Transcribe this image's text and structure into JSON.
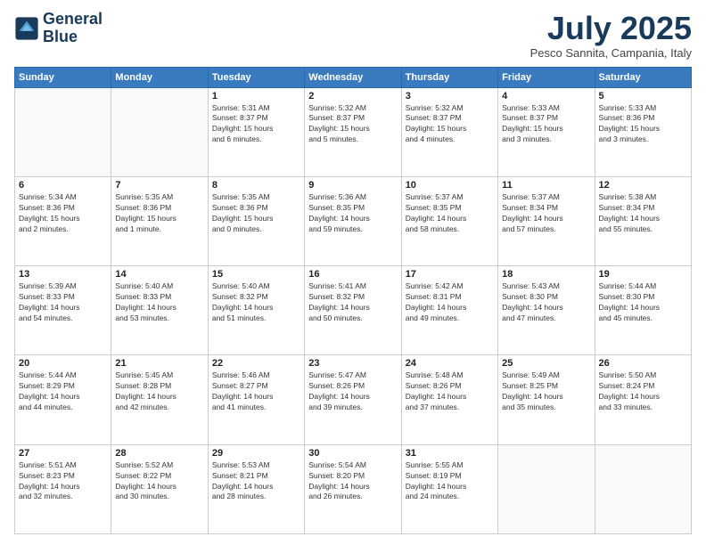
{
  "header": {
    "logo_line1": "General",
    "logo_line2": "Blue",
    "month": "July 2025",
    "location": "Pesco Sannita, Campania, Italy"
  },
  "days_of_week": [
    "Sunday",
    "Monday",
    "Tuesday",
    "Wednesday",
    "Thursday",
    "Friday",
    "Saturday"
  ],
  "weeks": [
    [
      {
        "day": "",
        "info": ""
      },
      {
        "day": "",
        "info": ""
      },
      {
        "day": "1",
        "info": "Sunrise: 5:31 AM\nSunset: 8:37 PM\nDaylight: 15 hours\nand 6 minutes."
      },
      {
        "day": "2",
        "info": "Sunrise: 5:32 AM\nSunset: 8:37 PM\nDaylight: 15 hours\nand 5 minutes."
      },
      {
        "day": "3",
        "info": "Sunrise: 5:32 AM\nSunset: 8:37 PM\nDaylight: 15 hours\nand 4 minutes."
      },
      {
        "day": "4",
        "info": "Sunrise: 5:33 AM\nSunset: 8:37 PM\nDaylight: 15 hours\nand 3 minutes."
      },
      {
        "day": "5",
        "info": "Sunrise: 5:33 AM\nSunset: 8:36 PM\nDaylight: 15 hours\nand 3 minutes."
      }
    ],
    [
      {
        "day": "6",
        "info": "Sunrise: 5:34 AM\nSunset: 8:36 PM\nDaylight: 15 hours\nand 2 minutes."
      },
      {
        "day": "7",
        "info": "Sunrise: 5:35 AM\nSunset: 8:36 PM\nDaylight: 15 hours\nand 1 minute."
      },
      {
        "day": "8",
        "info": "Sunrise: 5:35 AM\nSunset: 8:36 PM\nDaylight: 15 hours\nand 0 minutes."
      },
      {
        "day": "9",
        "info": "Sunrise: 5:36 AM\nSunset: 8:35 PM\nDaylight: 14 hours\nand 59 minutes."
      },
      {
        "day": "10",
        "info": "Sunrise: 5:37 AM\nSunset: 8:35 PM\nDaylight: 14 hours\nand 58 minutes."
      },
      {
        "day": "11",
        "info": "Sunrise: 5:37 AM\nSunset: 8:34 PM\nDaylight: 14 hours\nand 57 minutes."
      },
      {
        "day": "12",
        "info": "Sunrise: 5:38 AM\nSunset: 8:34 PM\nDaylight: 14 hours\nand 55 minutes."
      }
    ],
    [
      {
        "day": "13",
        "info": "Sunrise: 5:39 AM\nSunset: 8:33 PM\nDaylight: 14 hours\nand 54 minutes."
      },
      {
        "day": "14",
        "info": "Sunrise: 5:40 AM\nSunset: 8:33 PM\nDaylight: 14 hours\nand 53 minutes."
      },
      {
        "day": "15",
        "info": "Sunrise: 5:40 AM\nSunset: 8:32 PM\nDaylight: 14 hours\nand 51 minutes."
      },
      {
        "day": "16",
        "info": "Sunrise: 5:41 AM\nSunset: 8:32 PM\nDaylight: 14 hours\nand 50 minutes."
      },
      {
        "day": "17",
        "info": "Sunrise: 5:42 AM\nSunset: 8:31 PM\nDaylight: 14 hours\nand 49 minutes."
      },
      {
        "day": "18",
        "info": "Sunrise: 5:43 AM\nSunset: 8:30 PM\nDaylight: 14 hours\nand 47 minutes."
      },
      {
        "day": "19",
        "info": "Sunrise: 5:44 AM\nSunset: 8:30 PM\nDaylight: 14 hours\nand 45 minutes."
      }
    ],
    [
      {
        "day": "20",
        "info": "Sunrise: 5:44 AM\nSunset: 8:29 PM\nDaylight: 14 hours\nand 44 minutes."
      },
      {
        "day": "21",
        "info": "Sunrise: 5:45 AM\nSunset: 8:28 PM\nDaylight: 14 hours\nand 42 minutes."
      },
      {
        "day": "22",
        "info": "Sunrise: 5:46 AM\nSunset: 8:27 PM\nDaylight: 14 hours\nand 41 minutes."
      },
      {
        "day": "23",
        "info": "Sunrise: 5:47 AM\nSunset: 8:26 PM\nDaylight: 14 hours\nand 39 minutes."
      },
      {
        "day": "24",
        "info": "Sunrise: 5:48 AM\nSunset: 8:26 PM\nDaylight: 14 hours\nand 37 minutes."
      },
      {
        "day": "25",
        "info": "Sunrise: 5:49 AM\nSunset: 8:25 PM\nDaylight: 14 hours\nand 35 minutes."
      },
      {
        "day": "26",
        "info": "Sunrise: 5:50 AM\nSunset: 8:24 PM\nDaylight: 14 hours\nand 33 minutes."
      }
    ],
    [
      {
        "day": "27",
        "info": "Sunrise: 5:51 AM\nSunset: 8:23 PM\nDaylight: 14 hours\nand 32 minutes."
      },
      {
        "day": "28",
        "info": "Sunrise: 5:52 AM\nSunset: 8:22 PM\nDaylight: 14 hours\nand 30 minutes."
      },
      {
        "day": "29",
        "info": "Sunrise: 5:53 AM\nSunset: 8:21 PM\nDaylight: 14 hours\nand 28 minutes."
      },
      {
        "day": "30",
        "info": "Sunrise: 5:54 AM\nSunset: 8:20 PM\nDaylight: 14 hours\nand 26 minutes."
      },
      {
        "day": "31",
        "info": "Sunrise: 5:55 AM\nSunset: 8:19 PM\nDaylight: 14 hours\nand 24 minutes."
      },
      {
        "day": "",
        "info": ""
      },
      {
        "day": "",
        "info": ""
      }
    ]
  ]
}
